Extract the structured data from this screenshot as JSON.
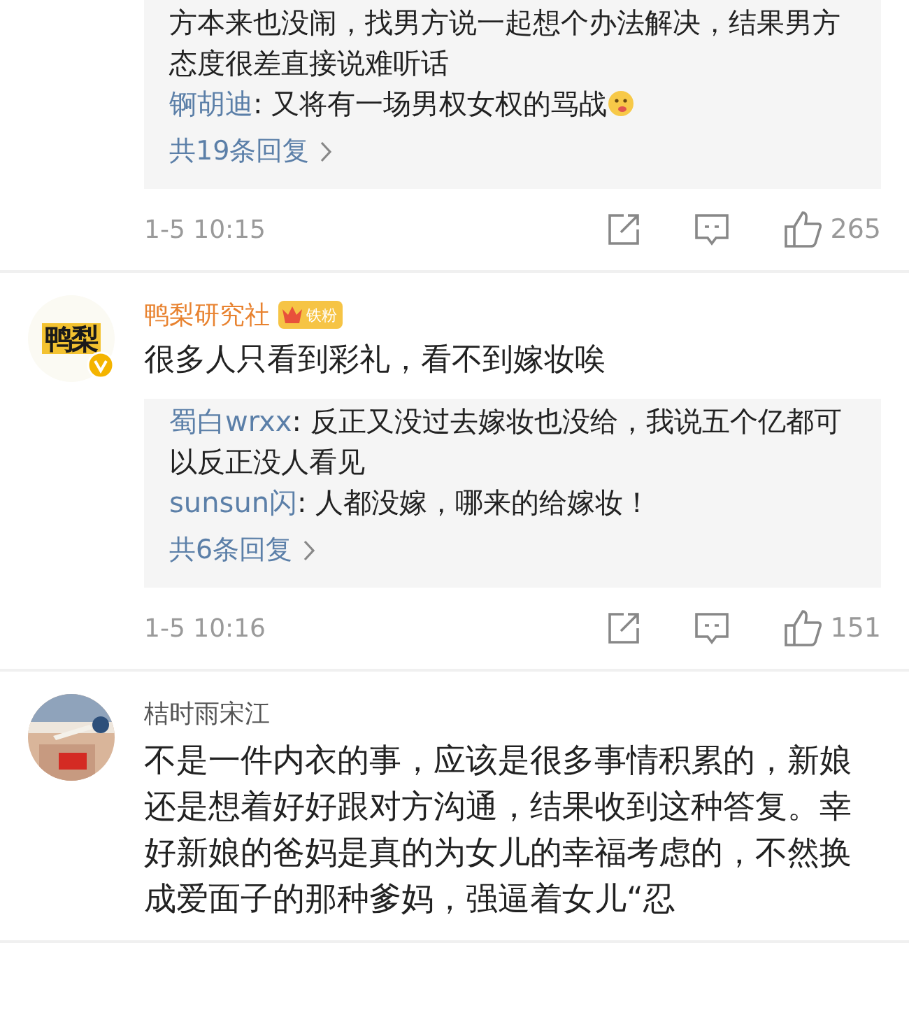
{
  "comments": [
    {
      "replies": {
        "lines": [
          {
            "text": "方本来也没闹，找男方说一起想个办法解决，结果男方态度很差直接说难听话"
          },
          {
            "author": "锕胡迪",
            "text": ": 又将有一场男权女权的骂战",
            "emoji": true
          }
        ],
        "more": "共19条回复"
      },
      "time": "1-5 10:15",
      "likes": "265"
    },
    {
      "author": {
        "name": "鸭梨研究社",
        "avatar": {
          "kind": "logo",
          "text": "鸭梨"
        },
        "verified": true,
        "badge": "铁粉",
        "vip": true
      },
      "text": "很多人只看到彩礼，看不到嫁妆唉",
      "replies": {
        "lines": [
          {
            "author": "蜀白wrxx",
            "text": ": 反正又没过去嫁妆也没给，我说五个亿都可以反正没人看见"
          },
          {
            "author": "sunsun闪",
            "text": ": 人都没嫁，哪来的给嫁妆！"
          }
        ],
        "more": "共6条回复"
      },
      "time": "1-5 10:16",
      "likes": "151"
    },
    {
      "author": {
        "name": "桔时雨宋江",
        "vip": false
      },
      "text": "不是一件内衣的事，应该是很多事情积累的，新娘还是想着好好跟对方沟通，结果收到这种答复。幸好新娘的爸妈是真的为女儿的幸福考虑的，不然换成爱面子的那种爹妈，强逼着女儿“忍"
    }
  ]
}
